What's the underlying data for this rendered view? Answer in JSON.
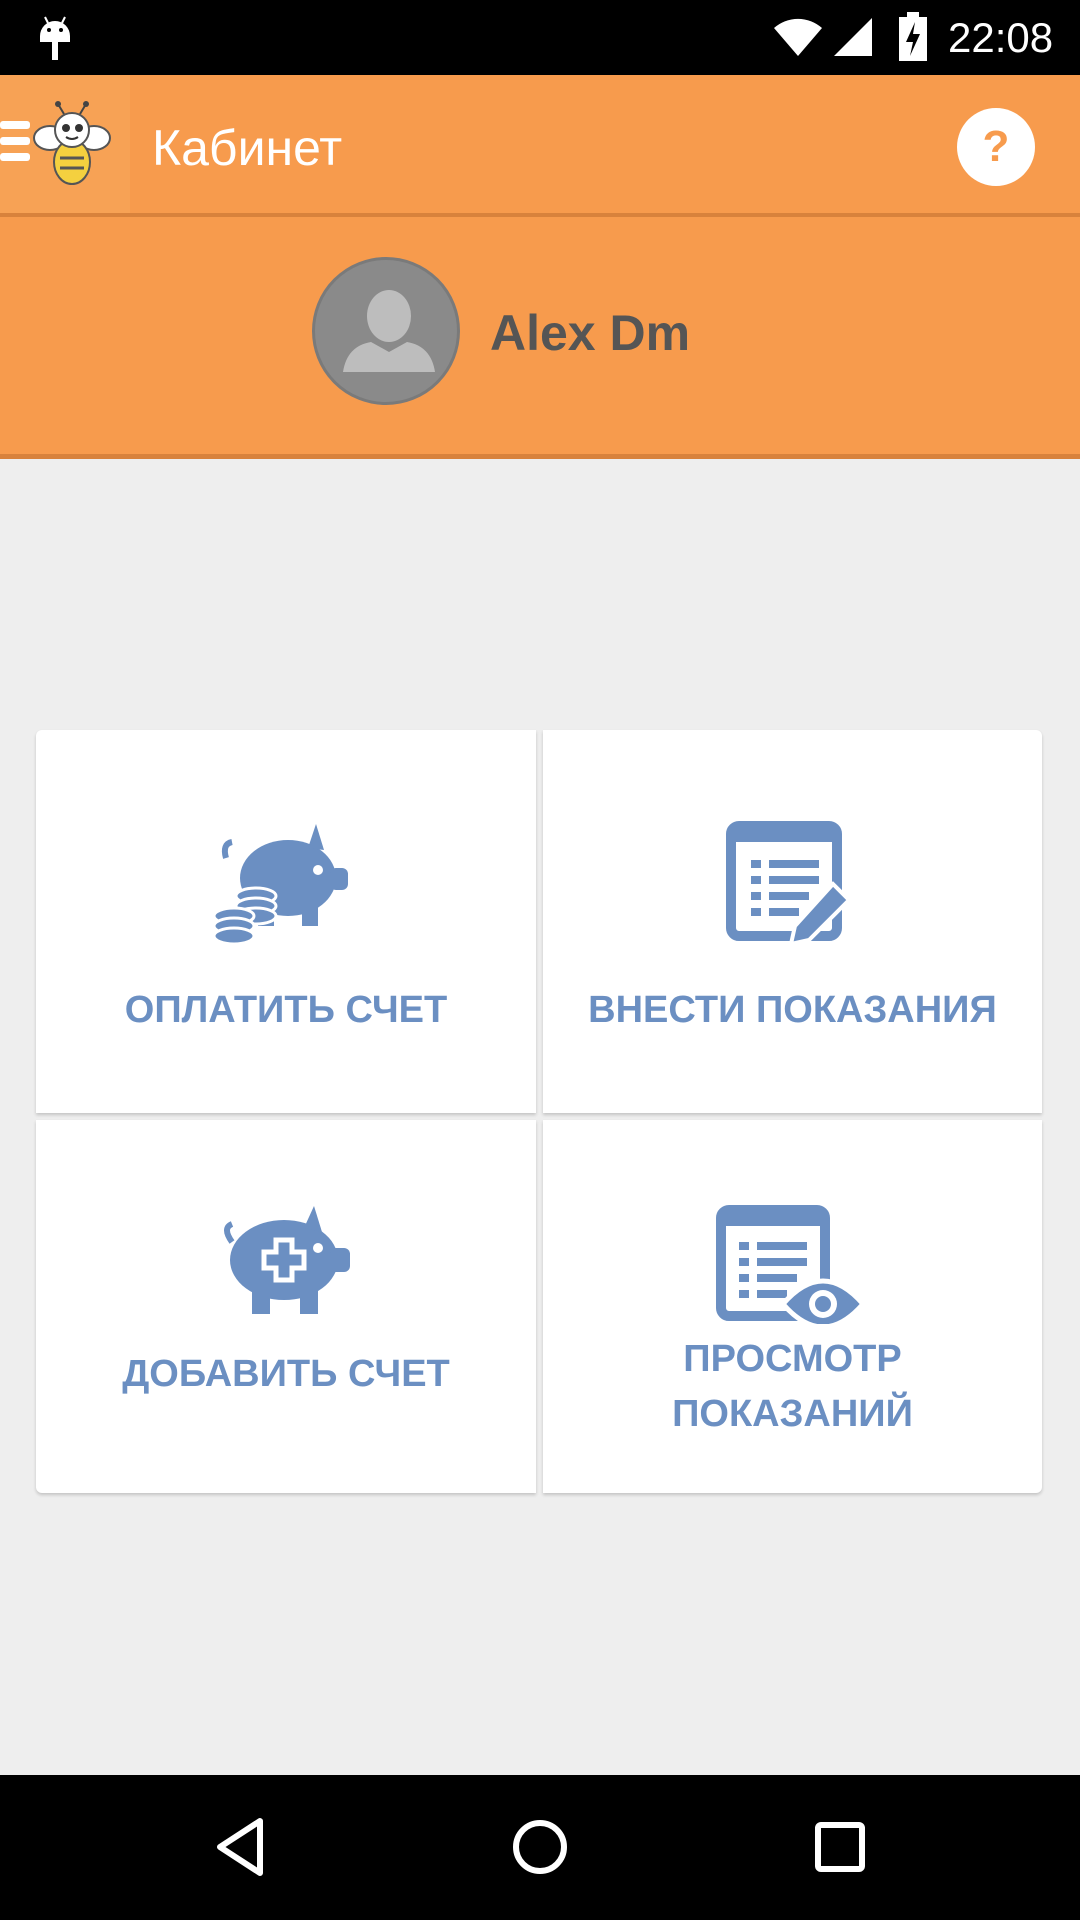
{
  "status_bar": {
    "time": "22:08",
    "icons": [
      "android-debug-icon",
      "wifi-icon",
      "signal-icon",
      "battery-charging-icon"
    ]
  },
  "app_bar": {
    "title": "Кабинет",
    "help_label": "?",
    "colors": {
      "background": "#f79b4d",
      "accent": "#d8823c"
    }
  },
  "profile": {
    "user_name": "Alex Dm"
  },
  "tiles": [
    {
      "label_lines": [
        "ОПЛАТИТЬ СЧЕТ"
      ],
      "icon": "piggy-bank-coins-icon"
    },
    {
      "label_lines": [
        "ВНЕСТИ ПОКАЗАНИЯ"
      ],
      "icon": "document-edit-icon"
    },
    {
      "label_lines": [
        "ДОБАВИТЬ СЧЕТ"
      ],
      "icon": "piggy-bank-add-icon"
    },
    {
      "label_lines": [
        "ПРОСМОТР",
        "ПОКАЗАНИЙ"
      ],
      "icon": "document-view-icon"
    }
  ],
  "tile_color": "#6b8fc2",
  "nav_bar": {
    "buttons": [
      "back-icon",
      "home-icon",
      "recents-icon"
    ]
  }
}
